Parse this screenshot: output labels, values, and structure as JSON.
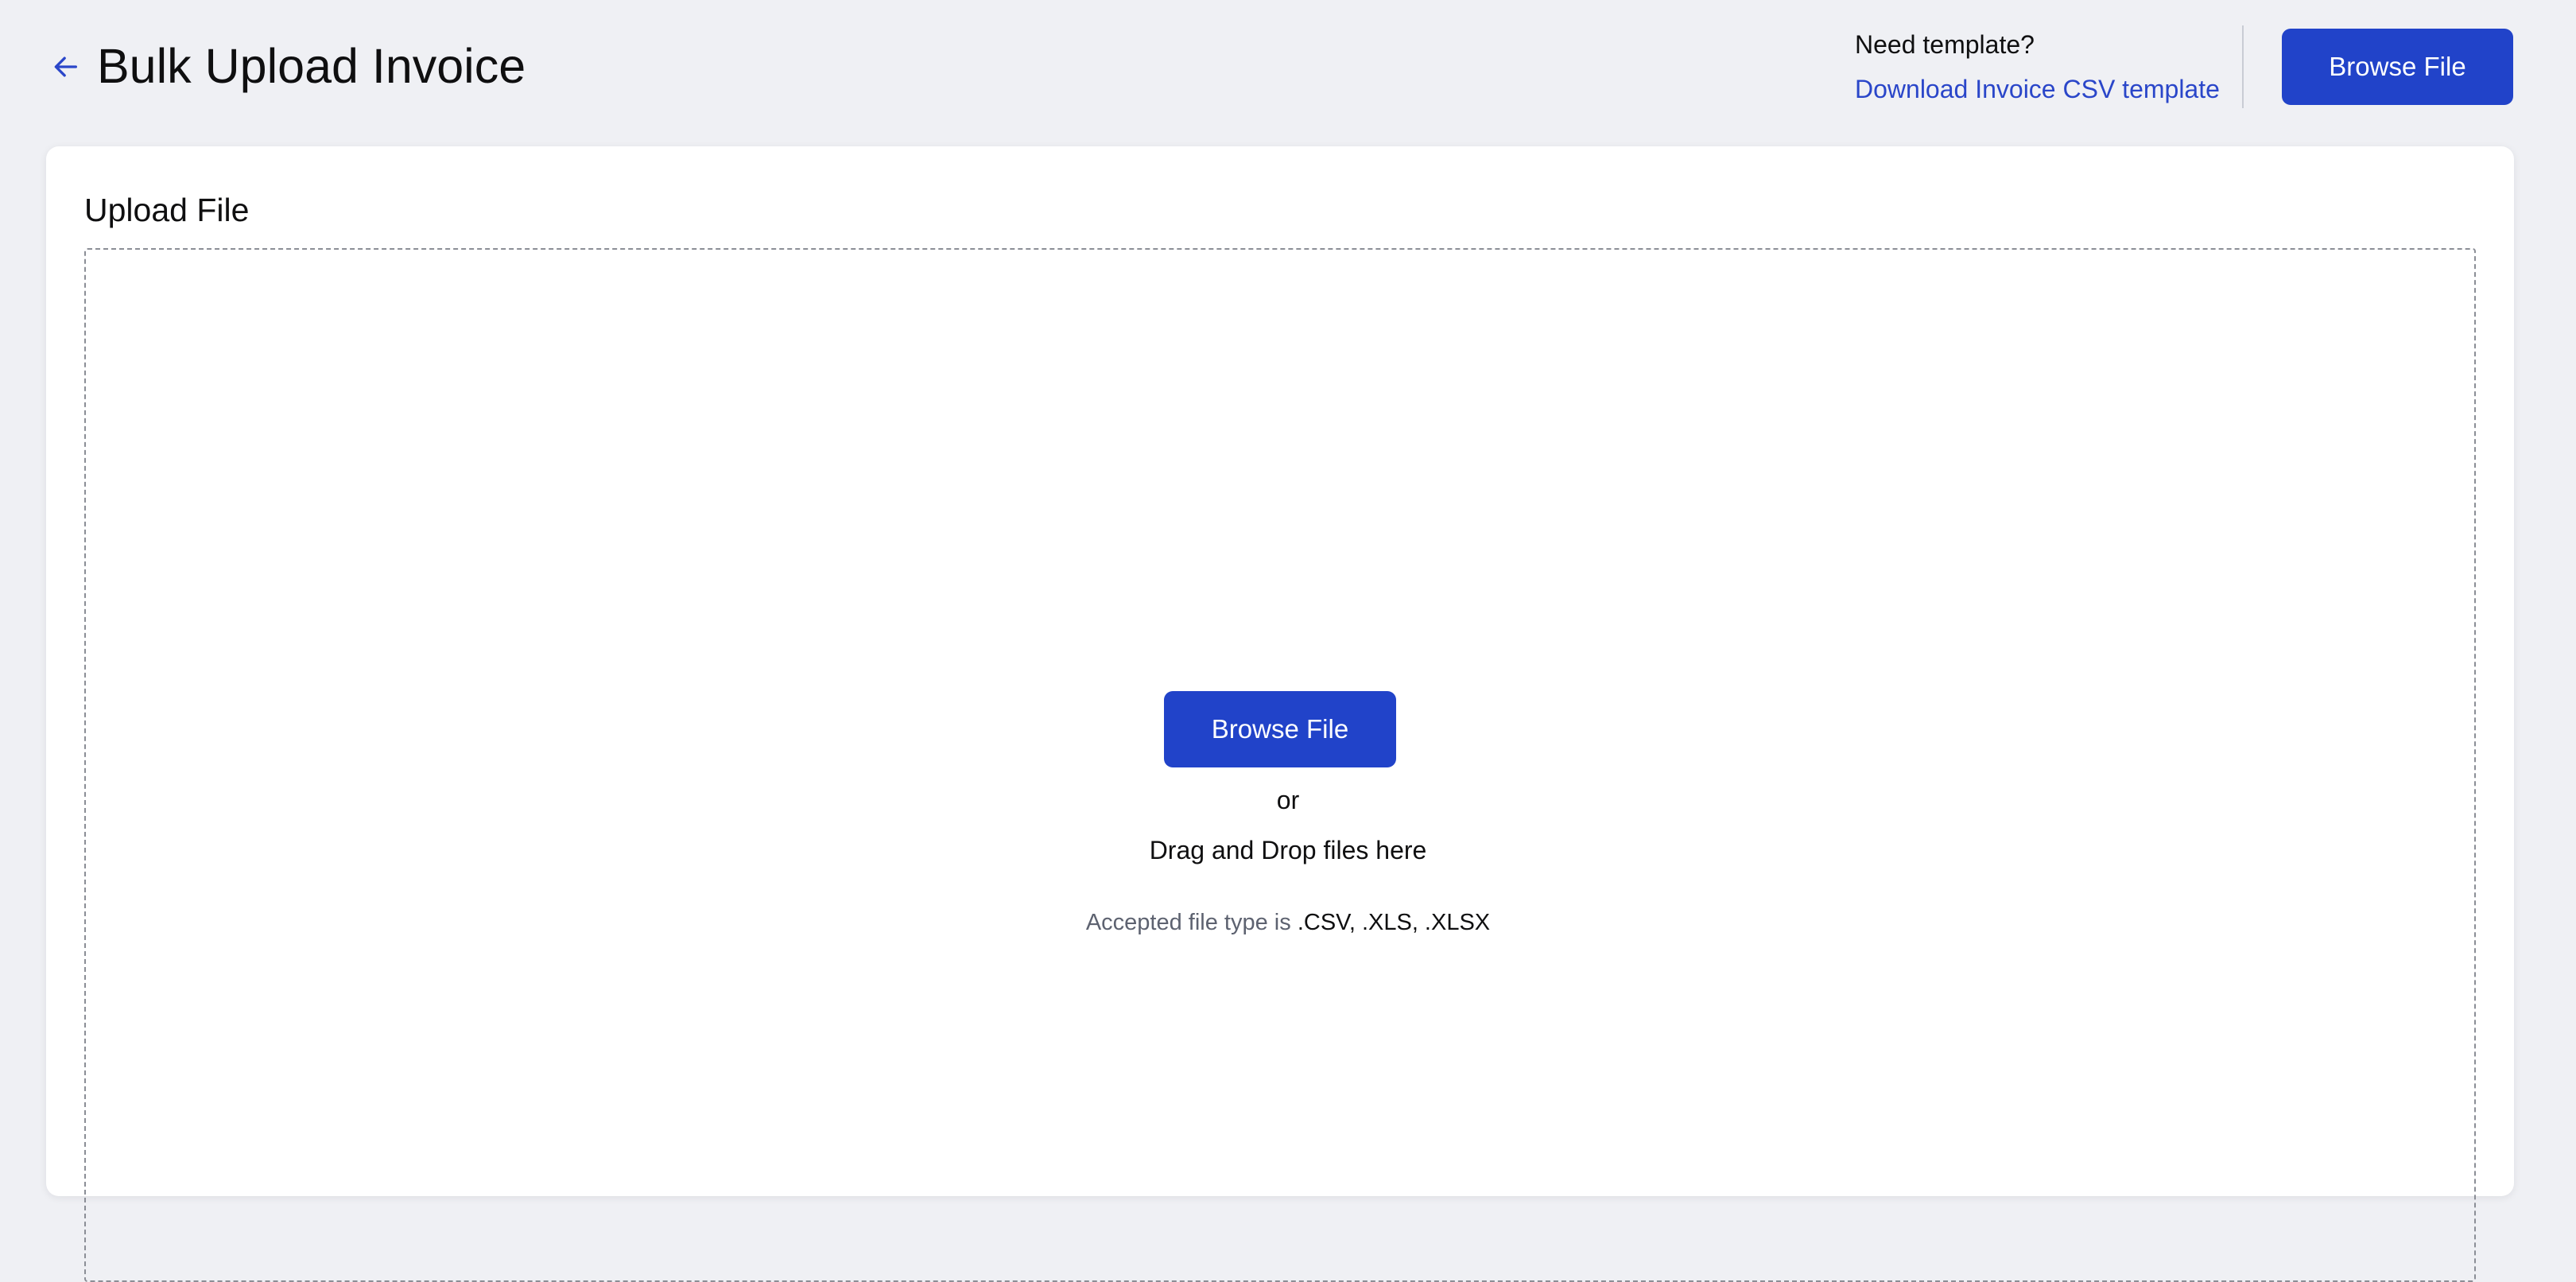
{
  "header": {
    "title": "Bulk Upload Invoice",
    "template_question": "Need template?",
    "template_link": "Download Invoice CSV template",
    "browse_label": "Browse File"
  },
  "upload_card": {
    "title": "Upload File",
    "browse_label": "Browse File",
    "or_text": "or",
    "drag_text": "Drag and Drop files here",
    "accepted_label": "Accepted file type is",
    "accepted_types": ".CSV, .XLS, .XLSX"
  },
  "icons": {
    "back": "arrow-left-icon"
  },
  "colors": {
    "accent": "#2143c9",
    "link": "#2a46c9",
    "background": "#eff0f4",
    "card": "#ffffff",
    "muted_text": "#5d6270"
  }
}
